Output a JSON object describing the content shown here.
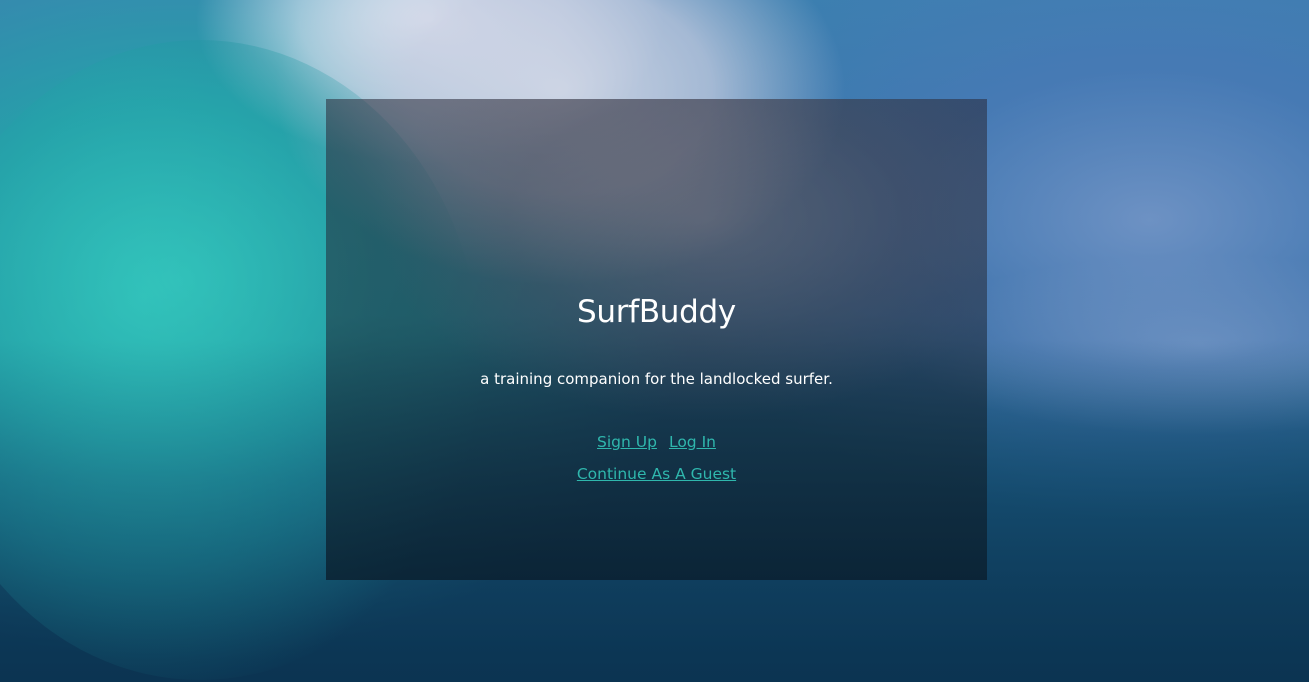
{
  "app": {
    "title": "SurfBuddy",
    "tagline": "a training companion for the landlocked surfer."
  },
  "auth": {
    "signup_label": "Sign Up",
    "login_label": "Log In",
    "guest_label": "Continue As A Guest"
  },
  "colors": {
    "link": "#2fb7ad",
    "text": "#ffffff",
    "card_overlay": "rgba(20,35,50,0.6)"
  }
}
